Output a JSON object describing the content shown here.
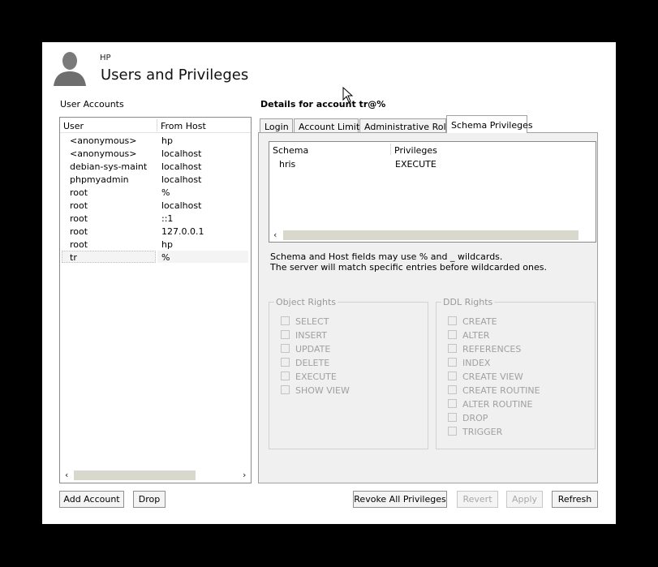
{
  "header": {
    "host": "HP",
    "title": "Users and Privileges"
  },
  "user_accounts": {
    "label": "User Accounts",
    "columns": {
      "user": "User",
      "host": "From Host"
    },
    "rows": [
      {
        "user": "<anonymous>",
        "host": "hp"
      },
      {
        "user": "<anonymous>",
        "host": "localhost"
      },
      {
        "user": "debian-sys-maint",
        "host": "localhost"
      },
      {
        "user": "phpmyadmin",
        "host": "localhost"
      },
      {
        "user": "root",
        "host": "%"
      },
      {
        "user": "root",
        "host": "localhost"
      },
      {
        "user": "root",
        "host": "::1"
      },
      {
        "user": "root",
        "host": "127.0.0.1"
      },
      {
        "user": "root",
        "host": "hp"
      },
      {
        "user": "tr",
        "host": "%"
      }
    ],
    "selected_index": 9
  },
  "details": {
    "label": "Details for account tr@%",
    "tabs": [
      "Login",
      "Account Limits",
      "Administrative Roles",
      "Schema Privileges"
    ],
    "active_tab": "Schema Privileges",
    "schema_table": {
      "columns": {
        "schema": "Schema",
        "privileges": "Privileges"
      },
      "rows": [
        {
          "schema": "hris",
          "privileges": "EXECUTE"
        }
      ]
    },
    "wildcard_note_line1": "Schema and Host fields may use % and _ wildcards.",
    "wildcard_note_line2": "The server will match specific entries before wildcarded ones.",
    "object_rights": {
      "label": "Object Rights",
      "items": [
        "SELECT",
        "INSERT",
        "UPDATE",
        "DELETE",
        "EXECUTE",
        "SHOW VIEW"
      ]
    },
    "ddl_rights": {
      "label": "DDL Rights",
      "items": [
        "CREATE",
        "ALTER",
        "REFERENCES",
        "INDEX",
        "CREATE VIEW",
        "CREATE ROUTINE",
        "ALTER ROUTINE",
        "DROP",
        "TRIGGER"
      ]
    }
  },
  "buttons": {
    "add_account": "Add Account",
    "drop": "Drop",
    "revoke_all": "Revoke All Privileges",
    "revert": "Revert",
    "apply": "Apply",
    "refresh": "Refresh"
  },
  "icons": {
    "avatar": "user-avatar-icon",
    "scroll_left": "‹",
    "scroll_right": "›"
  },
  "colors": {
    "background": "#000000",
    "window": "#ffffff",
    "panel": "#f0f0f0",
    "disabled_text": "#a0a0a0"
  }
}
